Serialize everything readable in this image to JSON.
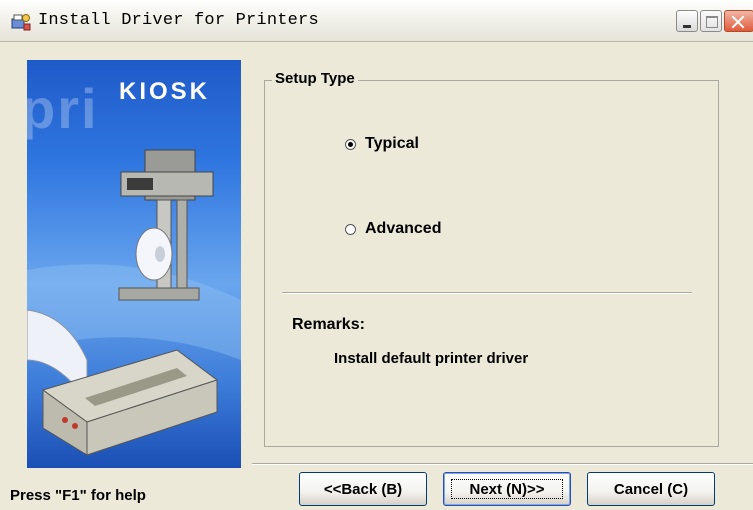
{
  "window": {
    "title": "Install Driver for Printers"
  },
  "banner": {
    "brand": "KIOSK",
    "faded_word": "pri"
  },
  "setup_type": {
    "legend": "Setup Type",
    "options": [
      {
        "label": "Typical",
        "selected": true
      },
      {
        "label": "Advanced",
        "selected": false
      }
    ]
  },
  "remarks": {
    "label": "Remarks:",
    "text": "Install default printer driver"
  },
  "footer": {
    "help_text": "Press \"F1\" for help",
    "back_label": "<<Back (B)",
    "next_label": "Next (N)>>",
    "cancel_label": "Cancel (C)"
  },
  "colors": {
    "dialog_background": "#ece9d8",
    "banner_blue": "#2f76e0",
    "close_button_red": "#e05b3a"
  }
}
